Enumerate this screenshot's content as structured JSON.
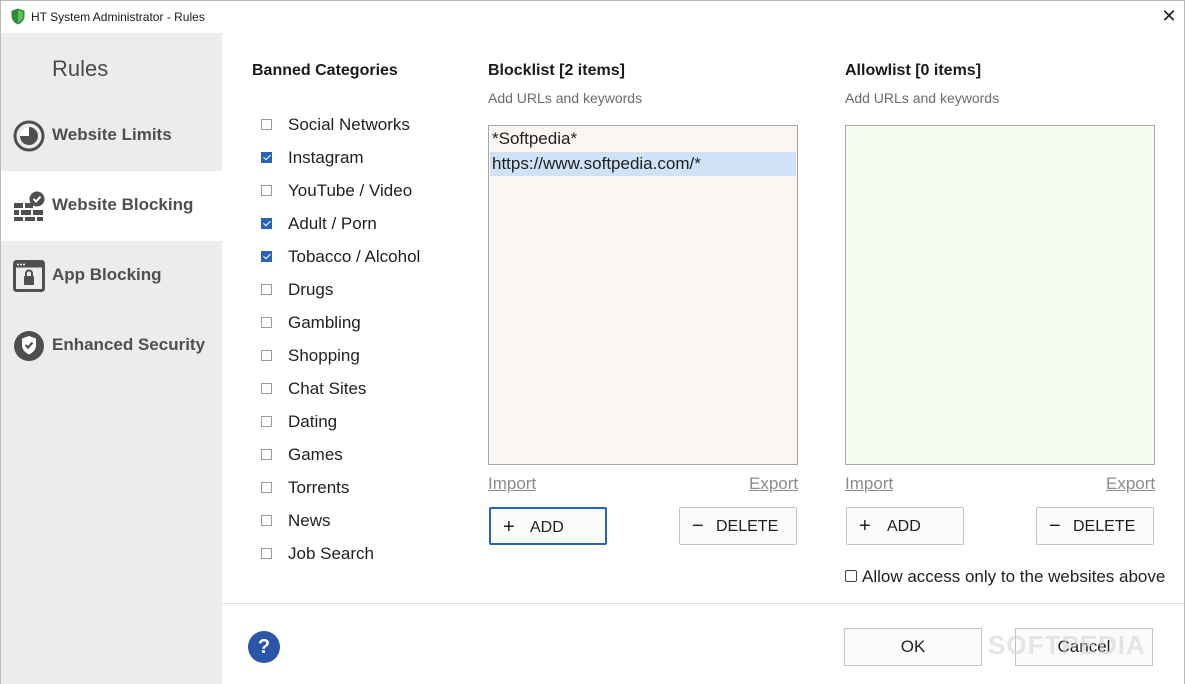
{
  "window": {
    "title": "HT System Administrator - Rules",
    "close_glyph": "✕"
  },
  "sidebar": {
    "title": "Rules",
    "items": [
      {
        "label": "Website Limits",
        "icon": "clock-icon",
        "active": false
      },
      {
        "label": "Website Blocking",
        "icon": "firewall-check-icon",
        "active": true
      },
      {
        "label": "App Blocking",
        "icon": "app-window-lock-icon",
        "active": false
      },
      {
        "label": "Enhanced Security",
        "icon": "shield-check-icon",
        "active": false
      }
    ]
  },
  "categories": {
    "title": "Banned Categories",
    "items": [
      {
        "label": "Social Networks",
        "checked": false
      },
      {
        "label": "Instagram",
        "checked": true
      },
      {
        "label": "YouTube / Video",
        "checked": false
      },
      {
        "label": "Adult / Porn",
        "checked": true
      },
      {
        "label": "Tobacco / Alcohol",
        "checked": true
      },
      {
        "label": "Drugs",
        "checked": false
      },
      {
        "label": "Gambling",
        "checked": false
      },
      {
        "label": "Shopping",
        "checked": false
      },
      {
        "label": "Chat Sites",
        "checked": false
      },
      {
        "label": "Dating",
        "checked": false
      },
      {
        "label": "Games",
        "checked": false
      },
      {
        "label": "Torrents",
        "checked": false
      },
      {
        "label": "News",
        "checked": false
      },
      {
        "label": "Job Search",
        "checked": false
      }
    ]
  },
  "blocklist": {
    "title": "Blocklist [2 items]",
    "subtitle": "Add URLs and keywords",
    "entries": [
      "*Softpedia*",
      "https://www.softpedia.com/*"
    ],
    "selected_index": 1,
    "import_label": "Import",
    "export_label": "Export",
    "add_label": "ADD",
    "delete_label": "DELETE",
    "background": "#fbf5f3"
  },
  "allowlist": {
    "title": "Allowlist [0 items]",
    "subtitle": "Add URLs and keywords",
    "entries": [],
    "import_label": "Import",
    "export_label": "Export",
    "add_label": "ADD",
    "delete_label": "DELETE",
    "allow_only_label": "Allow access only to the websites above",
    "allow_only_checked": false,
    "background": "#f4faee"
  },
  "footer": {
    "help_label": "?",
    "ok_label": "OK",
    "cancel_label": "Cancel",
    "watermark": "SOFTPEDIA"
  },
  "colors": {
    "accent": "#2a62b8",
    "sidebar_bg": "#ececec",
    "selected_row": "#cfe2f7"
  }
}
